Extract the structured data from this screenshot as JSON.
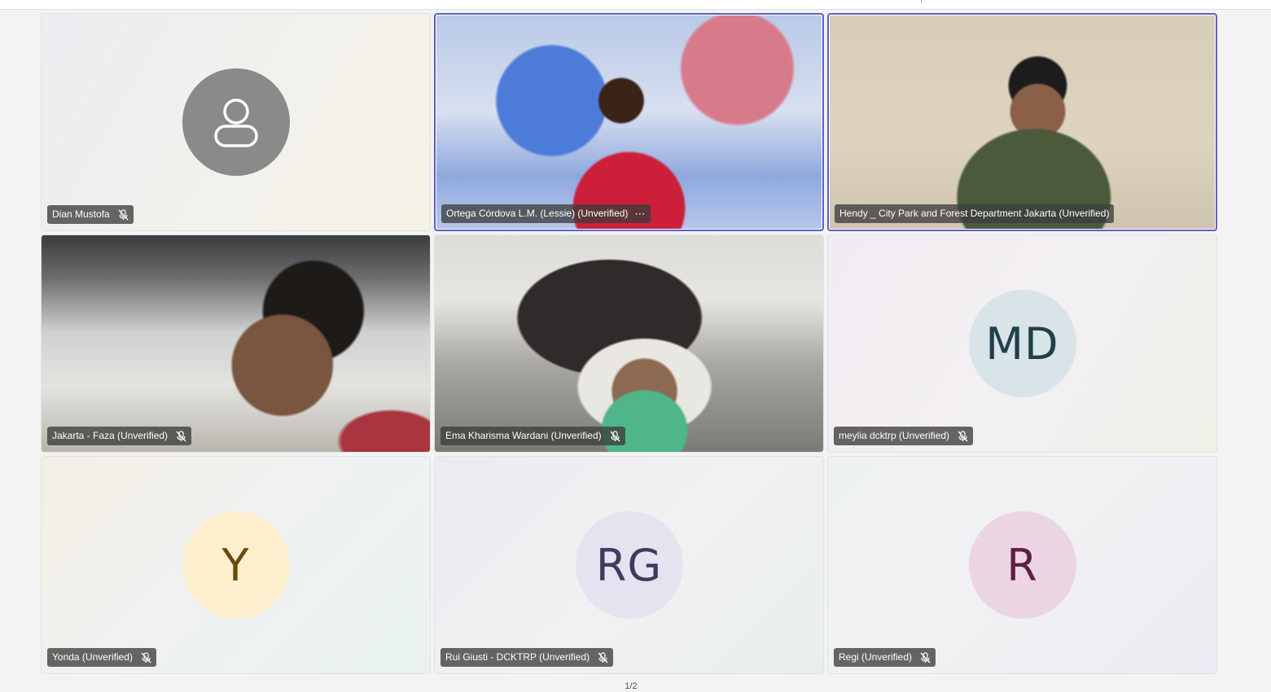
{
  "participants": [
    {
      "name": "Dian Mustofa",
      "status": "muted",
      "avatar": "person-icon",
      "avatar_bg": "#8a8a8a"
    },
    {
      "name": "Ortega Córdova L.M. (Lessie) (Unverified)",
      "status": "speaking",
      "video": true,
      "more": "⋯"
    },
    {
      "name": "Hendy _ City Park and Forest Department Jakarta (Unverified)",
      "status": "speaking",
      "video": true
    },
    {
      "name": "Jakarta - Faza (Unverified)",
      "status": "muted",
      "video": true
    },
    {
      "name": "Ema Kharisma Wardani (Unverified)",
      "status": "muted",
      "video": true
    },
    {
      "name": "meylia dcktrp (Unverified)",
      "status": "muted",
      "initials": "MD",
      "avatar_bg": "#d8e4e8",
      "avatar_fg": "#21404a"
    },
    {
      "name": "Yonda (Unverified)",
      "status": "muted",
      "initials": "Y",
      "avatar_bg": "#fdefce",
      "avatar_fg": "#6a4a0c"
    },
    {
      "name": "Rui Giusti - DCKTRP (Unverified)",
      "status": "muted",
      "initials": "RG",
      "avatar_bg": "#e7e2ef",
      "avatar_fg": "#3e3a60"
    },
    {
      "name": "Regi (Unverified)",
      "status": "muted",
      "initials": "R",
      "avatar_bg": "#ecd5e3",
      "avatar_fg": "#5e1e42"
    }
  ],
  "colors": {
    "speaking_border": "#5b5fc7",
    "label_bg": "#3c3c3c"
  },
  "pager": {
    "text": "1/2"
  }
}
